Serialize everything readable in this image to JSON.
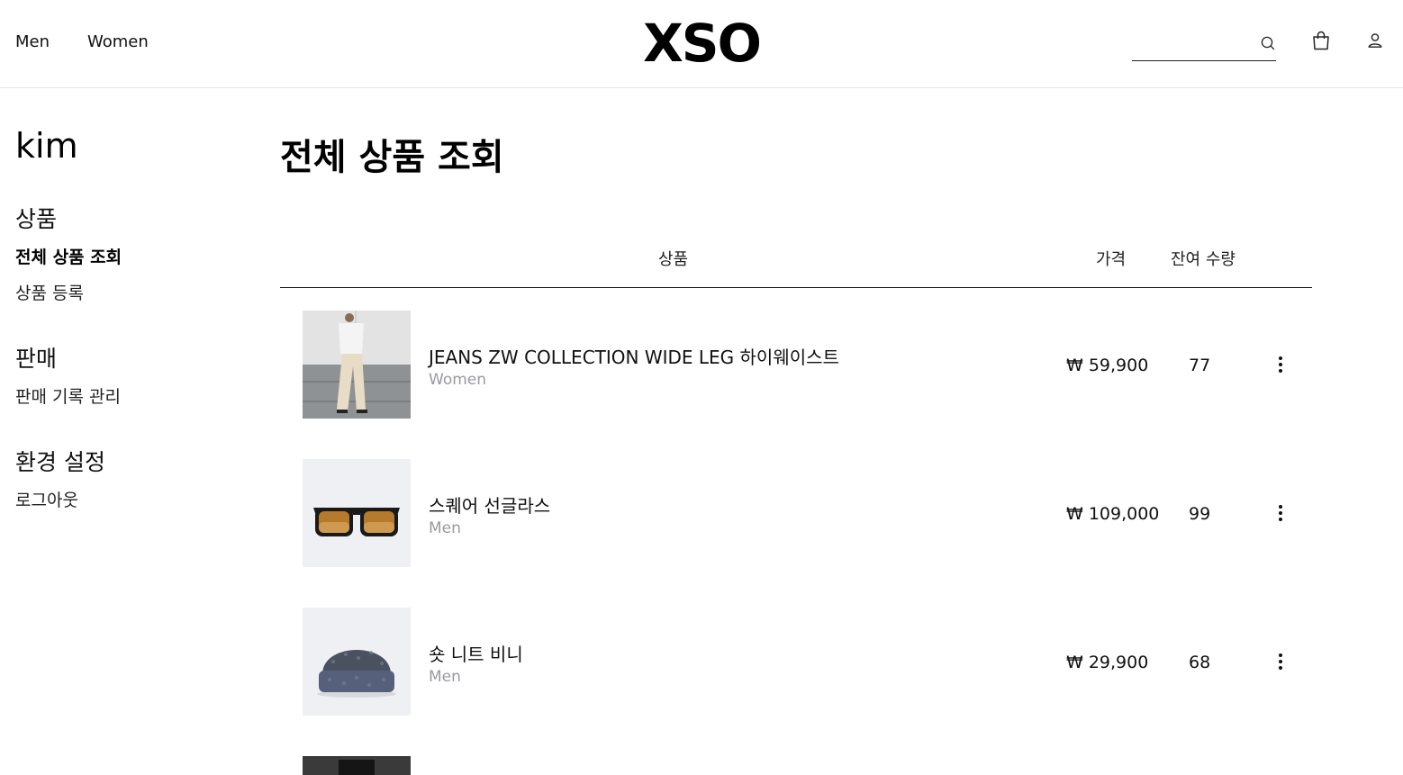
{
  "header": {
    "nav": {
      "men": "Men",
      "women": "Women"
    },
    "logo": "XSO",
    "search": {
      "placeholder": "",
      "value": ""
    }
  },
  "sidebar": {
    "username": "kim",
    "sections": {
      "products": {
        "title": "상품",
        "items": [
          "전체 상품 조회",
          "상품 등록"
        ]
      },
      "sales": {
        "title": "판매",
        "items": [
          "판매 기록 관리"
        ]
      },
      "settings": {
        "title": "환경 설정",
        "items": [
          "로그아웃"
        ]
      }
    }
  },
  "main": {
    "title": "전체 상품 조회",
    "columns": {
      "product": "상품",
      "price": "가격",
      "stock": "잔여 수량"
    },
    "rows": [
      {
        "name": "JEANS ZW COLLECTION WIDE LEG 하이웨이스트",
        "category": "Women",
        "price": "₩ 59,900",
        "stock": "77",
        "image": "model-wide-leg-jeans"
      },
      {
        "name": "스퀘어 선글라스",
        "category": "Men",
        "price": "₩ 109,000",
        "stock": "99",
        "image": "sunglasses"
      },
      {
        "name": "숏 니트 비니",
        "category": "Men",
        "price": "₩ 29,900",
        "stock": "68",
        "image": "knit-beanie"
      }
    ]
  },
  "colors": {
    "text": "#111111",
    "muted": "#9a9aa0",
    "thumb_bg": "#eff0f4",
    "divider": "#e6e6e6"
  }
}
